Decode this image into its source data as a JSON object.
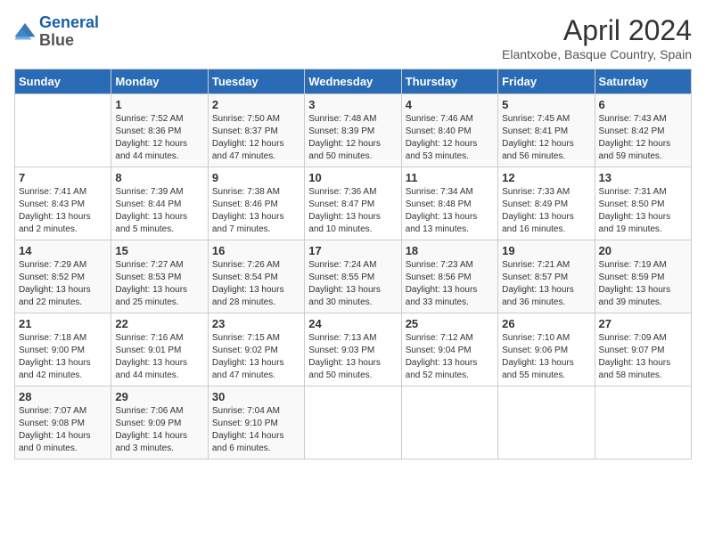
{
  "header": {
    "logo_line1": "General",
    "logo_line2": "Blue",
    "month": "April 2024",
    "location": "Elantxobe, Basque Country, Spain"
  },
  "weekdays": [
    "Sunday",
    "Monday",
    "Tuesday",
    "Wednesday",
    "Thursday",
    "Friday",
    "Saturday"
  ],
  "weeks": [
    [
      {
        "day": "",
        "sunrise": "",
        "sunset": "",
        "daylight": ""
      },
      {
        "day": "1",
        "sunrise": "Sunrise: 7:52 AM",
        "sunset": "Sunset: 8:36 PM",
        "daylight": "Daylight: 12 hours and 44 minutes."
      },
      {
        "day": "2",
        "sunrise": "Sunrise: 7:50 AM",
        "sunset": "Sunset: 8:37 PM",
        "daylight": "Daylight: 12 hours and 47 minutes."
      },
      {
        "day": "3",
        "sunrise": "Sunrise: 7:48 AM",
        "sunset": "Sunset: 8:39 PM",
        "daylight": "Daylight: 12 hours and 50 minutes."
      },
      {
        "day": "4",
        "sunrise": "Sunrise: 7:46 AM",
        "sunset": "Sunset: 8:40 PM",
        "daylight": "Daylight: 12 hours and 53 minutes."
      },
      {
        "day": "5",
        "sunrise": "Sunrise: 7:45 AM",
        "sunset": "Sunset: 8:41 PM",
        "daylight": "Daylight: 12 hours and 56 minutes."
      },
      {
        "day": "6",
        "sunrise": "Sunrise: 7:43 AM",
        "sunset": "Sunset: 8:42 PM",
        "daylight": "Daylight: 12 hours and 59 minutes."
      }
    ],
    [
      {
        "day": "7",
        "sunrise": "Sunrise: 7:41 AM",
        "sunset": "Sunset: 8:43 PM",
        "daylight": "Daylight: 13 hours and 2 minutes."
      },
      {
        "day": "8",
        "sunrise": "Sunrise: 7:39 AM",
        "sunset": "Sunset: 8:44 PM",
        "daylight": "Daylight: 13 hours and 5 minutes."
      },
      {
        "day": "9",
        "sunrise": "Sunrise: 7:38 AM",
        "sunset": "Sunset: 8:46 PM",
        "daylight": "Daylight: 13 hours and 7 minutes."
      },
      {
        "day": "10",
        "sunrise": "Sunrise: 7:36 AM",
        "sunset": "Sunset: 8:47 PM",
        "daylight": "Daylight: 13 hours and 10 minutes."
      },
      {
        "day": "11",
        "sunrise": "Sunrise: 7:34 AM",
        "sunset": "Sunset: 8:48 PM",
        "daylight": "Daylight: 13 hours and 13 minutes."
      },
      {
        "day": "12",
        "sunrise": "Sunrise: 7:33 AM",
        "sunset": "Sunset: 8:49 PM",
        "daylight": "Daylight: 13 hours and 16 minutes."
      },
      {
        "day": "13",
        "sunrise": "Sunrise: 7:31 AM",
        "sunset": "Sunset: 8:50 PM",
        "daylight": "Daylight: 13 hours and 19 minutes."
      }
    ],
    [
      {
        "day": "14",
        "sunrise": "Sunrise: 7:29 AM",
        "sunset": "Sunset: 8:52 PM",
        "daylight": "Daylight: 13 hours and 22 minutes."
      },
      {
        "day": "15",
        "sunrise": "Sunrise: 7:27 AM",
        "sunset": "Sunset: 8:53 PM",
        "daylight": "Daylight: 13 hours and 25 minutes."
      },
      {
        "day": "16",
        "sunrise": "Sunrise: 7:26 AM",
        "sunset": "Sunset: 8:54 PM",
        "daylight": "Daylight: 13 hours and 28 minutes."
      },
      {
        "day": "17",
        "sunrise": "Sunrise: 7:24 AM",
        "sunset": "Sunset: 8:55 PM",
        "daylight": "Daylight: 13 hours and 30 minutes."
      },
      {
        "day": "18",
        "sunrise": "Sunrise: 7:23 AM",
        "sunset": "Sunset: 8:56 PM",
        "daylight": "Daylight: 13 hours and 33 minutes."
      },
      {
        "day": "19",
        "sunrise": "Sunrise: 7:21 AM",
        "sunset": "Sunset: 8:57 PM",
        "daylight": "Daylight: 13 hours and 36 minutes."
      },
      {
        "day": "20",
        "sunrise": "Sunrise: 7:19 AM",
        "sunset": "Sunset: 8:59 PM",
        "daylight": "Daylight: 13 hours and 39 minutes."
      }
    ],
    [
      {
        "day": "21",
        "sunrise": "Sunrise: 7:18 AM",
        "sunset": "Sunset: 9:00 PM",
        "daylight": "Daylight: 13 hours and 42 minutes."
      },
      {
        "day": "22",
        "sunrise": "Sunrise: 7:16 AM",
        "sunset": "Sunset: 9:01 PM",
        "daylight": "Daylight: 13 hours and 44 minutes."
      },
      {
        "day": "23",
        "sunrise": "Sunrise: 7:15 AM",
        "sunset": "Sunset: 9:02 PM",
        "daylight": "Daylight: 13 hours and 47 minutes."
      },
      {
        "day": "24",
        "sunrise": "Sunrise: 7:13 AM",
        "sunset": "Sunset: 9:03 PM",
        "daylight": "Daylight: 13 hours and 50 minutes."
      },
      {
        "day": "25",
        "sunrise": "Sunrise: 7:12 AM",
        "sunset": "Sunset: 9:04 PM",
        "daylight": "Daylight: 13 hours and 52 minutes."
      },
      {
        "day": "26",
        "sunrise": "Sunrise: 7:10 AM",
        "sunset": "Sunset: 9:06 PM",
        "daylight": "Daylight: 13 hours and 55 minutes."
      },
      {
        "day": "27",
        "sunrise": "Sunrise: 7:09 AM",
        "sunset": "Sunset: 9:07 PM",
        "daylight": "Daylight: 13 hours and 58 minutes."
      }
    ],
    [
      {
        "day": "28",
        "sunrise": "Sunrise: 7:07 AM",
        "sunset": "Sunset: 9:08 PM",
        "daylight": "Daylight: 14 hours and 0 minutes."
      },
      {
        "day": "29",
        "sunrise": "Sunrise: 7:06 AM",
        "sunset": "Sunset: 9:09 PM",
        "daylight": "Daylight: 14 hours and 3 minutes."
      },
      {
        "day": "30",
        "sunrise": "Sunrise: 7:04 AM",
        "sunset": "Sunset: 9:10 PM",
        "daylight": "Daylight: 14 hours and 6 minutes."
      },
      {
        "day": "",
        "sunrise": "",
        "sunset": "",
        "daylight": ""
      },
      {
        "day": "",
        "sunrise": "",
        "sunset": "",
        "daylight": ""
      },
      {
        "day": "",
        "sunrise": "",
        "sunset": "",
        "daylight": ""
      },
      {
        "day": "",
        "sunrise": "",
        "sunset": "",
        "daylight": ""
      }
    ]
  ]
}
